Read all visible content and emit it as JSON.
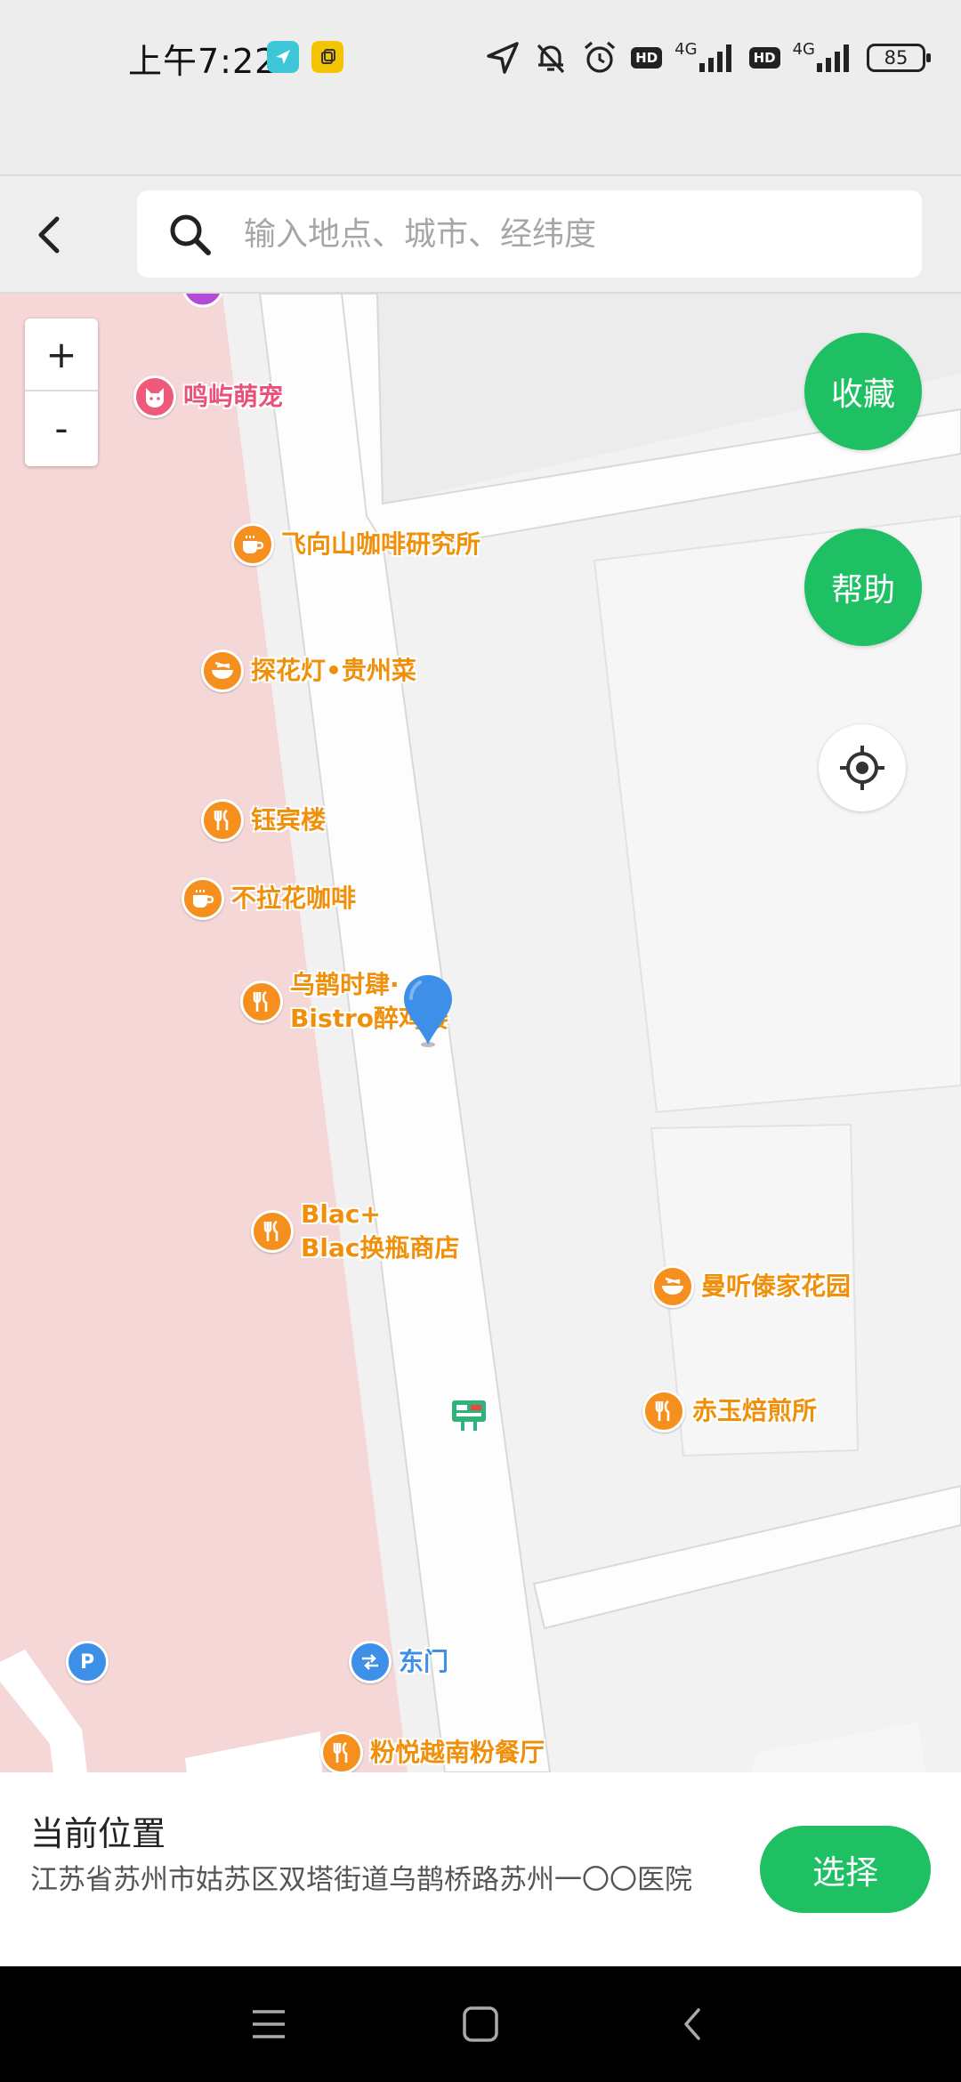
{
  "status_bar": {
    "time": "上午7:22",
    "network1": "4G",
    "network2": "4G",
    "hd1": "HD",
    "hd2": "HD",
    "battery": "85",
    "icons": [
      "send-icon",
      "copy-icon",
      "location-arrow-icon",
      "mute-icon",
      "alarm-icon",
      "signal-icon"
    ]
  },
  "header": {
    "back_icon": "chevron-left-icon",
    "search_placeholder": "输入地点、城市、经纬度",
    "search_value": ""
  },
  "map": {
    "zoom_in": "+",
    "zoom_out": "-",
    "favorite_label": "收藏",
    "help_label": "帮助",
    "locate_icon": "crosshair-icon",
    "pin_icon": "map-pin-icon",
    "bus_stop_icon": "bus-stop-icon",
    "pois": [
      {
        "name": "鸣屿萌宠",
        "icon": "pet-icon"
      },
      {
        "name": "飞向山咖啡研究所",
        "icon": "coffee-icon"
      },
      {
        "name": "探花灯•贵州菜",
        "icon": "bowl-icon"
      },
      {
        "name": "钰宾楼",
        "icon": "utensils-icon"
      },
      {
        "name": "不拉花咖啡",
        "icon": "coffee-icon"
      },
      {
        "name_line1": "乌鹊时肆·",
        "name_line2": "Bistro醉鸡楼",
        "icon": "utensils-icon"
      },
      {
        "name_line1": "Blac+",
        "name_line2": "Blac换瓶商店",
        "icon": "utensils-icon"
      },
      {
        "name": "曼听傣家花园",
        "icon": "bowl-icon"
      },
      {
        "name": "赤玉焙煎所",
        "icon": "utensils-icon"
      },
      {
        "name": "东门",
        "icon": "entrance-icon"
      },
      {
        "name": "粉悦越南粉餐厅",
        "icon": "utensils-icon"
      },
      {
        "name": "P",
        "icon": "parking-icon"
      }
    ]
  },
  "bottom_panel": {
    "title": "当前位置",
    "address": "江苏省苏州市姑苏区双塔街道乌鹊桥路苏州一〇〇医院",
    "select_label": "选择"
  },
  "nav_bar": {
    "items": [
      "menu-icon",
      "home-icon",
      "back-icon"
    ]
  },
  "colors": {
    "accent_green": "#1fbf63",
    "poi_orange": "#f5901e",
    "poi_pink": "#ee5a7a",
    "poi_blue": "#3d8fe8",
    "pin_blue": "#3d8fe8",
    "area_pink": "#f6d7d7"
  }
}
